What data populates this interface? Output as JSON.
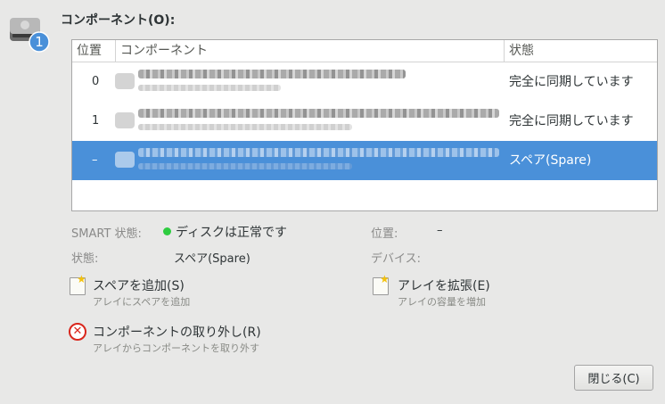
{
  "header": {
    "title": "コンポーネント(O):",
    "disk_badge": "1",
    "icon": "harddisk-icon"
  },
  "table": {
    "columns": [
      "位置",
      "コンポーネント",
      "状態"
    ],
    "rows": [
      {
        "position": "0",
        "status": "完全に同期しています",
        "selected": false
      },
      {
        "position": "1",
        "status": "完全に同期しています",
        "selected": false
      },
      {
        "position": "–",
        "status": "スペア(Spare)",
        "selected": true
      }
    ]
  },
  "info": {
    "smart_label": "SMART 状態:",
    "smart_value": "ディスクは正常です",
    "state_label": "状態:",
    "state_value": "スペア(Spare)",
    "position_label": "位置:",
    "position_value": "–",
    "device_label": "デバイス:",
    "device_value": "",
    "smart_ok_color": "#2ecc40"
  },
  "actions": {
    "add_spare": {
      "title": "スペアを追加(S)",
      "subtitle": "アレイにスペアを追加",
      "icon": "note-new-icon"
    },
    "expand": {
      "title": "アレイを拡張(E)",
      "subtitle": "アレイの容量を増加",
      "icon": "note-new-icon"
    },
    "remove": {
      "title": "コンポーネントの取り外し(R)",
      "subtitle": "アレイからコンポーネントを取り外す",
      "icon": "remove-icon"
    }
  },
  "footer": {
    "close_label": "閉じる(C)"
  },
  "colors": {
    "selection": "#4a90d9",
    "background": "#e8e8e7"
  }
}
